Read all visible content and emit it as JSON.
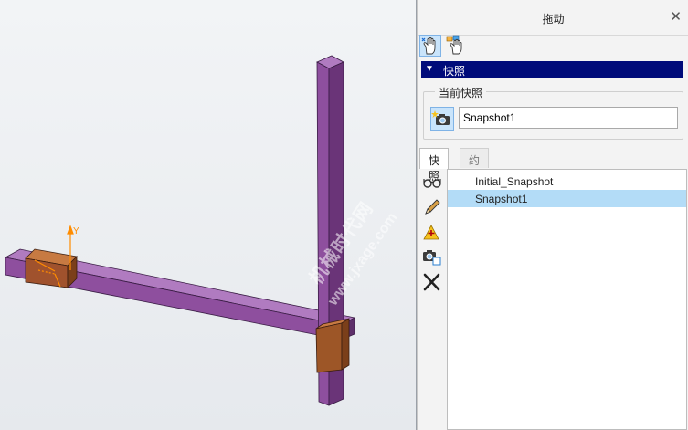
{
  "viewport": {
    "axis_labels": {
      "y": "Y"
    },
    "watermark": {
      "line1": "机械时代网",
      "line2": "www.jxage.com"
    },
    "colors": {
      "beam": "#8e4f9e",
      "block": "#a0522d",
      "axis": "#ff8c00"
    }
  },
  "panel": {
    "title": "拖动",
    "close_glyph": "✕",
    "toolbar": {
      "tool1_icon": "drag-hand-icon",
      "tool2_icon": "drag-hand-constraint-icon"
    },
    "section": {
      "label": "快照"
    },
    "current": {
      "label": "当前快照",
      "value": "Snapshot1",
      "icon": "camera-snapshot-icon"
    },
    "tabs": [
      {
        "label": "快照"
      },
      {
        "label": "约束"
      }
    ],
    "side_icons": [
      "glasses-icon",
      "pencil-icon",
      "warning-add-icon",
      "camera-copy-icon",
      "delete-x-icon"
    ],
    "snapshots": [
      {
        "label": "Initial_Snapshot",
        "selected": false
      },
      {
        "label": "Snapshot1",
        "selected": true
      }
    ]
  }
}
